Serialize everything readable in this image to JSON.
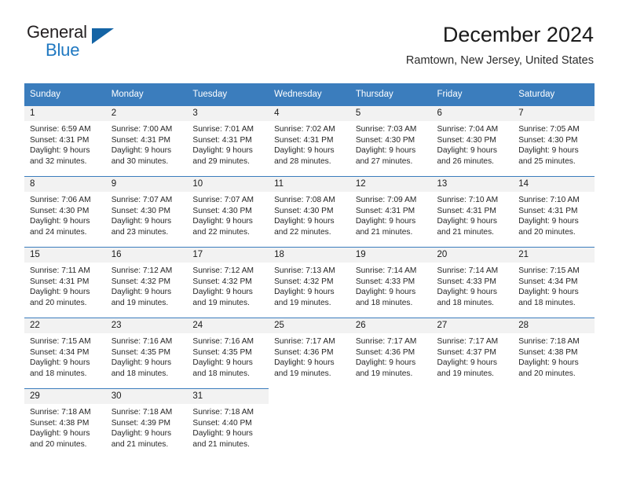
{
  "brand": {
    "name_part1": "General",
    "name_part2": "Blue",
    "accent_color": "#1464a5",
    "text_color": "#231f20"
  },
  "header": {
    "title": "December 2024",
    "subtitle": "Ramtown, New Jersey, United States"
  },
  "theme": {
    "header_bg": "#3b7dbd",
    "daynum_bg": "#f2f2f2",
    "page_bg": "#ffffff"
  },
  "weekday_headers": [
    "Sunday",
    "Monday",
    "Tuesday",
    "Wednesday",
    "Thursday",
    "Friday",
    "Saturday"
  ],
  "weeks": [
    [
      {
        "day": "1",
        "info": "Sunrise: 6:59 AM\nSunset: 4:31 PM\nDaylight: 9 hours\nand 32 minutes."
      },
      {
        "day": "2",
        "info": "Sunrise: 7:00 AM\nSunset: 4:31 PM\nDaylight: 9 hours\nand 30 minutes."
      },
      {
        "day": "3",
        "info": "Sunrise: 7:01 AM\nSunset: 4:31 PM\nDaylight: 9 hours\nand 29 minutes."
      },
      {
        "day": "4",
        "info": "Sunrise: 7:02 AM\nSunset: 4:31 PM\nDaylight: 9 hours\nand 28 minutes."
      },
      {
        "day": "5",
        "info": "Sunrise: 7:03 AM\nSunset: 4:30 PM\nDaylight: 9 hours\nand 27 minutes."
      },
      {
        "day": "6",
        "info": "Sunrise: 7:04 AM\nSunset: 4:30 PM\nDaylight: 9 hours\nand 26 minutes."
      },
      {
        "day": "7",
        "info": "Sunrise: 7:05 AM\nSunset: 4:30 PM\nDaylight: 9 hours\nand 25 minutes."
      }
    ],
    [
      {
        "day": "8",
        "info": "Sunrise: 7:06 AM\nSunset: 4:30 PM\nDaylight: 9 hours\nand 24 minutes."
      },
      {
        "day": "9",
        "info": "Sunrise: 7:07 AM\nSunset: 4:30 PM\nDaylight: 9 hours\nand 23 minutes."
      },
      {
        "day": "10",
        "info": "Sunrise: 7:07 AM\nSunset: 4:30 PM\nDaylight: 9 hours\nand 22 minutes."
      },
      {
        "day": "11",
        "info": "Sunrise: 7:08 AM\nSunset: 4:30 PM\nDaylight: 9 hours\nand 22 minutes."
      },
      {
        "day": "12",
        "info": "Sunrise: 7:09 AM\nSunset: 4:31 PM\nDaylight: 9 hours\nand 21 minutes."
      },
      {
        "day": "13",
        "info": "Sunrise: 7:10 AM\nSunset: 4:31 PM\nDaylight: 9 hours\nand 21 minutes."
      },
      {
        "day": "14",
        "info": "Sunrise: 7:10 AM\nSunset: 4:31 PM\nDaylight: 9 hours\nand 20 minutes."
      }
    ],
    [
      {
        "day": "15",
        "info": "Sunrise: 7:11 AM\nSunset: 4:31 PM\nDaylight: 9 hours\nand 20 minutes."
      },
      {
        "day": "16",
        "info": "Sunrise: 7:12 AM\nSunset: 4:32 PM\nDaylight: 9 hours\nand 19 minutes."
      },
      {
        "day": "17",
        "info": "Sunrise: 7:12 AM\nSunset: 4:32 PM\nDaylight: 9 hours\nand 19 minutes."
      },
      {
        "day": "18",
        "info": "Sunrise: 7:13 AM\nSunset: 4:32 PM\nDaylight: 9 hours\nand 19 minutes."
      },
      {
        "day": "19",
        "info": "Sunrise: 7:14 AM\nSunset: 4:33 PM\nDaylight: 9 hours\nand 18 minutes."
      },
      {
        "day": "20",
        "info": "Sunrise: 7:14 AM\nSunset: 4:33 PM\nDaylight: 9 hours\nand 18 minutes."
      },
      {
        "day": "21",
        "info": "Sunrise: 7:15 AM\nSunset: 4:34 PM\nDaylight: 9 hours\nand 18 minutes."
      }
    ],
    [
      {
        "day": "22",
        "info": "Sunrise: 7:15 AM\nSunset: 4:34 PM\nDaylight: 9 hours\nand 18 minutes."
      },
      {
        "day": "23",
        "info": "Sunrise: 7:16 AM\nSunset: 4:35 PM\nDaylight: 9 hours\nand 18 minutes."
      },
      {
        "day": "24",
        "info": "Sunrise: 7:16 AM\nSunset: 4:35 PM\nDaylight: 9 hours\nand 18 minutes."
      },
      {
        "day": "25",
        "info": "Sunrise: 7:17 AM\nSunset: 4:36 PM\nDaylight: 9 hours\nand 19 minutes."
      },
      {
        "day": "26",
        "info": "Sunrise: 7:17 AM\nSunset: 4:36 PM\nDaylight: 9 hours\nand 19 minutes."
      },
      {
        "day": "27",
        "info": "Sunrise: 7:17 AM\nSunset: 4:37 PM\nDaylight: 9 hours\nand 19 minutes."
      },
      {
        "day": "28",
        "info": "Sunrise: 7:18 AM\nSunset: 4:38 PM\nDaylight: 9 hours\nand 20 minutes."
      }
    ],
    [
      {
        "day": "29",
        "info": "Sunrise: 7:18 AM\nSunset: 4:38 PM\nDaylight: 9 hours\nand 20 minutes."
      },
      {
        "day": "30",
        "info": "Sunrise: 7:18 AM\nSunset: 4:39 PM\nDaylight: 9 hours\nand 21 minutes."
      },
      {
        "day": "31",
        "info": "Sunrise: 7:18 AM\nSunset: 4:40 PM\nDaylight: 9 hours\nand 21 minutes."
      },
      {
        "day": "",
        "info": ""
      },
      {
        "day": "",
        "info": ""
      },
      {
        "day": "",
        "info": ""
      },
      {
        "day": "",
        "info": ""
      }
    ]
  ]
}
